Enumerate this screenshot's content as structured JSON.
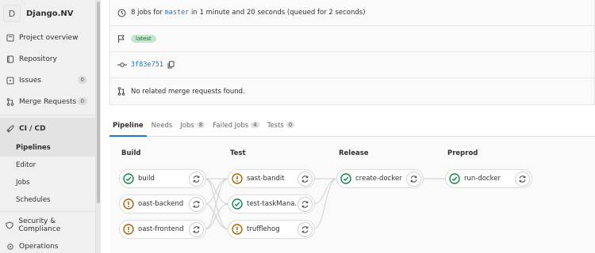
{
  "project": {
    "avatar_letter": "D",
    "name": "Django.NV"
  },
  "sidebar": {
    "items": [
      {
        "label": "Project overview"
      },
      {
        "label": "Repository"
      },
      {
        "label": "Issues",
        "count": "0"
      },
      {
        "label": "Merge Requests",
        "count": "0"
      },
      {
        "label": "CI / CD"
      },
      {
        "label": "Security & Compliance"
      },
      {
        "label": "Operations"
      }
    ],
    "ci_sub": [
      "Pipelines",
      "Editor",
      "Jobs",
      "Schedules"
    ]
  },
  "pipeline_info": {
    "summary_pre": "8 jobs for ",
    "branch": "master",
    "summary_post": " in 1 minute and 20 seconds (queued for 2 seconds)",
    "tag": "latest",
    "commit": "3f83e751",
    "merge_requests": "No related merge requests found."
  },
  "tabs": [
    {
      "label": "Pipeline"
    },
    {
      "label": "Needs"
    },
    {
      "label": "Jobs",
      "count": "8"
    },
    {
      "label": "Failed Jobs",
      "count": "4"
    },
    {
      "label": "Tests",
      "count": "0"
    }
  ],
  "stages": [
    {
      "title": "Build",
      "jobs": [
        {
          "name": "build",
          "status": "success"
        },
        {
          "name": "oast-backend",
          "status": "warning"
        },
        {
          "name": "oast-frontend",
          "status": "warning"
        }
      ]
    },
    {
      "title": "Test",
      "jobs": [
        {
          "name": "sast-bandit",
          "status": "warning"
        },
        {
          "name": "test-taskMana...",
          "status": "success"
        },
        {
          "name": "trufflehog",
          "status": "warning"
        }
      ]
    },
    {
      "title": "Release",
      "jobs": [
        {
          "name": "create-docker",
          "status": "success"
        }
      ]
    },
    {
      "title": "Preprod",
      "jobs": [
        {
          "name": "run-docker",
          "status": "success"
        }
      ]
    }
  ],
  "colors": {
    "success": "#108548",
    "warning": "#ab6100",
    "accent": "#1f75cb"
  }
}
